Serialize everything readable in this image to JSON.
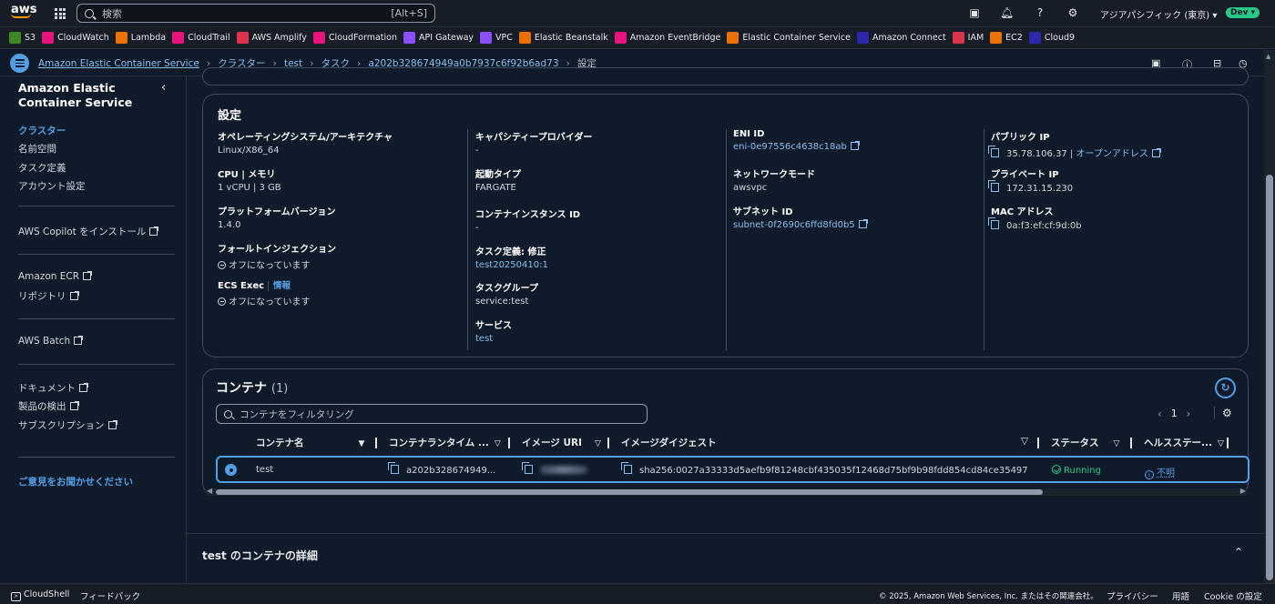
{
  "topbar": {
    "logo": "aws",
    "search_placeholder": "検索",
    "search_hint": "[Alt+S]",
    "region": "アジアパシフィック (東京) ▾",
    "badge": "Dev ▾",
    "icons": [
      "cloudshell-icon",
      "bell-icon",
      "help-icon",
      "gear-icon"
    ]
  },
  "favorites": [
    {
      "label": "S3",
      "color": "#3f8624"
    },
    {
      "label": "CloudWatch",
      "color": "#e7157b"
    },
    {
      "label": "Lambda",
      "color": "#ed7100"
    },
    {
      "label": "CloudTrail",
      "color": "#e7157b"
    },
    {
      "label": "AWS Amplify",
      "color": "#dd344c"
    },
    {
      "label": "CloudFormation",
      "color": "#e7157b"
    },
    {
      "label": "API Gateway",
      "color": "#8c4fff"
    },
    {
      "label": "VPC",
      "color": "#8c4fff"
    },
    {
      "label": "Elastic Beanstalk",
      "color": "#ed7100"
    },
    {
      "label": "Amazon EventBridge",
      "color": "#e7157b"
    },
    {
      "label": "Elastic Container Service",
      "color": "#ed7100"
    },
    {
      "label": "Amazon Connect",
      "color": "#2e27ad"
    },
    {
      "label": "IAM",
      "color": "#dd344c"
    },
    {
      "label": "EC2",
      "color": "#ed7100"
    },
    {
      "label": "Cloud9",
      "color": "#2e27ad"
    }
  ],
  "breadcrumbs": {
    "items": [
      "Amazon Elastic Container Service",
      "クラスター",
      "test",
      "タスク",
      "a202b328674949a0b7937c6f92b6ad73"
    ],
    "current": "設定"
  },
  "sidebar": {
    "title": "Amazon Elastic Container Service",
    "items": [
      "クラスター",
      "名前空間",
      "タスク定義",
      "アカウント設定"
    ],
    "copilot": "AWS Copilot をインストール",
    "ecr": "Amazon ECR",
    "repo": "リポジトリ",
    "batch": "AWS Batch",
    "docs": "ドキュメント",
    "products": "製品の検出",
    "subs": "サブスクリプション",
    "feedback": "ご意見をお聞かせください"
  },
  "settings": {
    "title": "設定",
    "os_k": "オペレーティングシステム/アーキテクチャ",
    "os_v": "Linux/X86_64",
    "cpu_k": "CPU | メモリ",
    "cpu_v": "1 vCPU | 3 GB",
    "platform_k": "プラットフォームバージョン",
    "platform_v": "1.4.0",
    "fault_k": "フォールトインジェクション",
    "fault_v": "オフになっています",
    "ecsexec_k": "ECS Exec",
    "ecsexec_info": "情報",
    "ecsexec_v": "オフになっています",
    "capacity_k": "キャパシティープロバイダー",
    "capacity_v": "-",
    "launch_k": "起動タイプ",
    "launch_v": "FARGATE",
    "ci_k": "コンテナインスタンス ID",
    "ci_v": "-",
    "taskdef_k": "タスク定義: 修正",
    "taskdef_v": "test20250410:1",
    "group_k": "タスクグループ",
    "group_v": "service:test",
    "service_k": "サービス",
    "service_v": "test",
    "eni_k": "ENI ID",
    "eni_v": "eni-0e97556c4638c18ab",
    "netmode_k": "ネットワークモード",
    "netmode_v": "awsvpc",
    "subnet_k": "サブネット ID",
    "subnet_v": "subnet-0f2690c6ffd8fd0b5",
    "pubip_k": "パブリック IP",
    "pubip_v": "35.78.106.37",
    "pubip_open": "オープンアドレス",
    "privip_k": "プライベート IP",
    "privip_v": "172.31.15.230",
    "mac_k": "MAC アドレス",
    "mac_v": "0a:f3:ef:cf:9d:0b"
  },
  "containers": {
    "title": "コンテナ",
    "count": "(1)",
    "filter_placeholder": "コンテナをフィルタリング",
    "page": "1",
    "columns": [
      "コンテナ名",
      "コンテナランタイム ...",
      "イメージ URI",
      "イメージダイジェスト",
      "ステータス",
      "ヘルスステー..."
    ],
    "rows": [
      {
        "name": "test",
        "runtime": "a202b328674949...",
        "digest": "sha256:0027a33333d5aefb9f81248cbf435035f12468d75bf9b98fdd854cd84ce35497",
        "status": "Running",
        "health": "不明"
      }
    ]
  },
  "details": {
    "title": "test のコンテナの詳細"
  },
  "footer": {
    "cloudshell": "CloudShell",
    "feedback": "フィードバック",
    "copyright": "© 2025, Amazon Web Services, Inc. またはその関連会社。",
    "privacy": "プライバシー",
    "terms": "用語",
    "cookie": "Cookie の設定"
  }
}
